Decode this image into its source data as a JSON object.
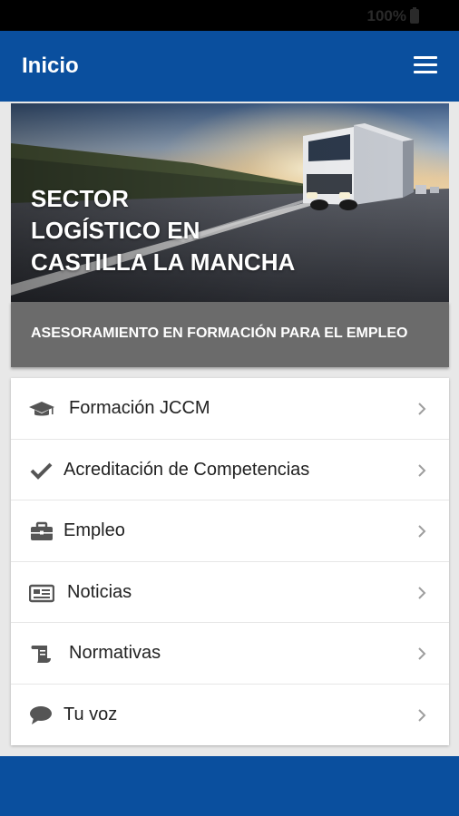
{
  "status_bar": {
    "battery_text": "100%",
    "icon": "battery-icon"
  },
  "app_bar": {
    "title": "Inicio",
    "menu_icon": "hamburger-menu-icon"
  },
  "hero": {
    "title_lines": [
      "SECTOR",
      "LOGÍSTICO EN",
      "CASTILLA LA MANCHA"
    ],
    "image": "truck-highway-sunset-image"
  },
  "banner": {
    "text": "ASESORAMIENTO EN FORMACIÓN PARA EL EMPLEO"
  },
  "menu": {
    "items": [
      {
        "label": "Formación JCCM",
        "icon": "graduation-cap-icon"
      },
      {
        "label": "Acreditación de Competencias",
        "icon": "checkmark-icon"
      },
      {
        "label": "Empleo",
        "icon": "briefcase-icon"
      },
      {
        "label": "Noticias",
        "icon": "newspaper-icon"
      },
      {
        "label": "Normativas",
        "icon": "scroll-icon"
      },
      {
        "label": "Tu voz",
        "icon": "speech-bubble-icon"
      }
    ]
  },
  "colors": {
    "primary": "#0a4f9e",
    "banner": "#6b6b6b",
    "icon": "#555555",
    "chevron": "#9e9e9e"
  }
}
